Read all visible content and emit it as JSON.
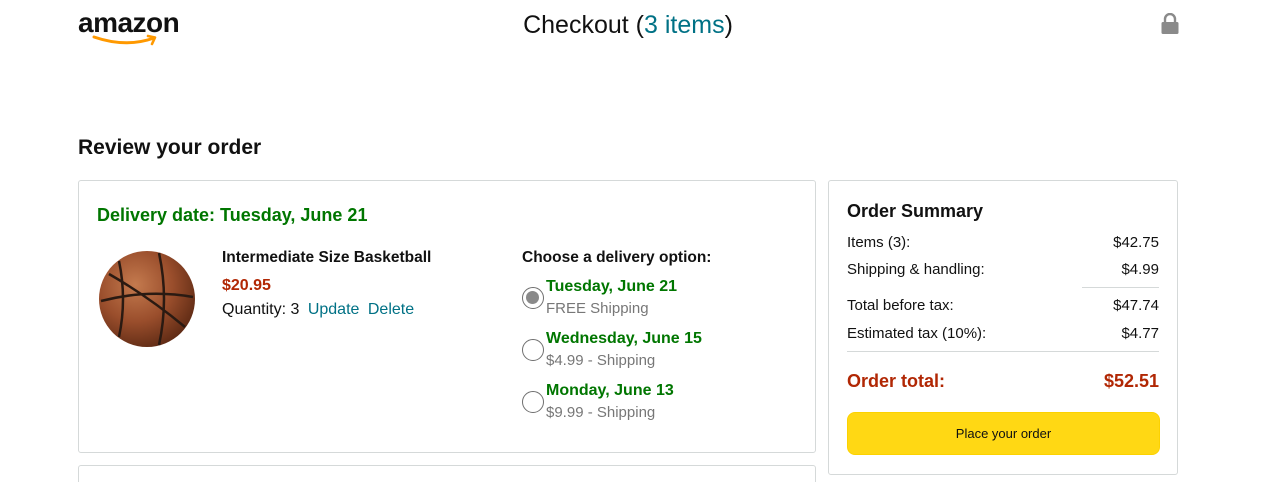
{
  "header": {
    "logo_text": "amazon",
    "checkout_label": "Checkout",
    "items_link": "3 items",
    "lock_icon": "lock-icon"
  },
  "review_title": "Review your order",
  "order": {
    "delivery_date": "Delivery date: Tuesday, June 21",
    "product": {
      "name": "Intermediate Size Basketball",
      "price": "$20.95",
      "quantity_label": "Quantity: 3",
      "update_label": "Update",
      "delete_label": "Delete",
      "image_icon": "basketball-image"
    },
    "delivery_options": {
      "heading": "Choose a delivery option:",
      "options": [
        {
          "date": "Tuesday, June 21",
          "shipping": "FREE Shipping",
          "selected": true
        },
        {
          "date": "Wednesday, June 15",
          "shipping": "$4.99 - Shipping",
          "selected": false
        },
        {
          "date": "Monday, June 13",
          "shipping": "$9.99 - Shipping",
          "selected": false
        }
      ]
    }
  },
  "summary": {
    "title": "Order Summary",
    "items_label": "Items (3):",
    "items_value": "$42.75",
    "shipping_label": "Shipping & handling:",
    "shipping_value": "$4.99",
    "before_tax_label": "Total before tax:",
    "before_tax_value": "$47.74",
    "tax_label": "Estimated tax (10%):",
    "tax_value": "$4.77",
    "total_label": "Order total:",
    "total_value": "$52.51",
    "place_order_label": "Place your order"
  },
  "colors": {
    "link": "#007185",
    "green": "#007600",
    "price_red": "#B12704",
    "button_yellow": "#FFD814",
    "border": "#D5D9D9"
  }
}
